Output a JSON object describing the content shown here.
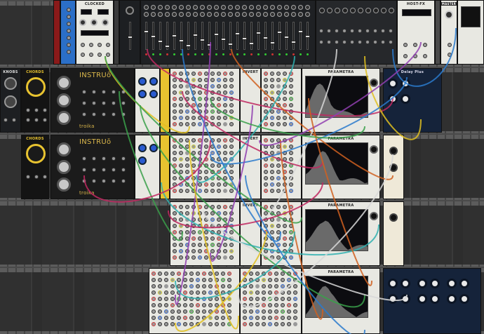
{
  "modules": {
    "clocked": "CLOCKED",
    "host_fx": "HOST-FX",
    "master": "MASTER",
    "knobs": "KNOBS",
    "chords_1": "CHORDS",
    "chords_2": "CHORDS",
    "instruo_1": "INSTRUō",
    "instruo_2": "INSTRUō",
    "troika_1": "troika",
    "troika_2": "troika",
    "invert_1": "INVERT",
    "invert_2": "INVERT",
    "invert_3": "INVERT",
    "parametra_1": "PARAMETRA",
    "parametra_2": "PARAMETRA",
    "parametra_3": "PARAMETRA",
    "parametra_4": "PARAMETRA",
    "delay_plus": "Delay Plus"
  },
  "colors": {
    "cables": [
      "#e0c020",
      "#3aa04a",
      "#c02860",
      "#2a7acc",
      "#9040b0",
      "#d06020",
      "#30b0b0",
      "#d8d8d8"
    ]
  }
}
